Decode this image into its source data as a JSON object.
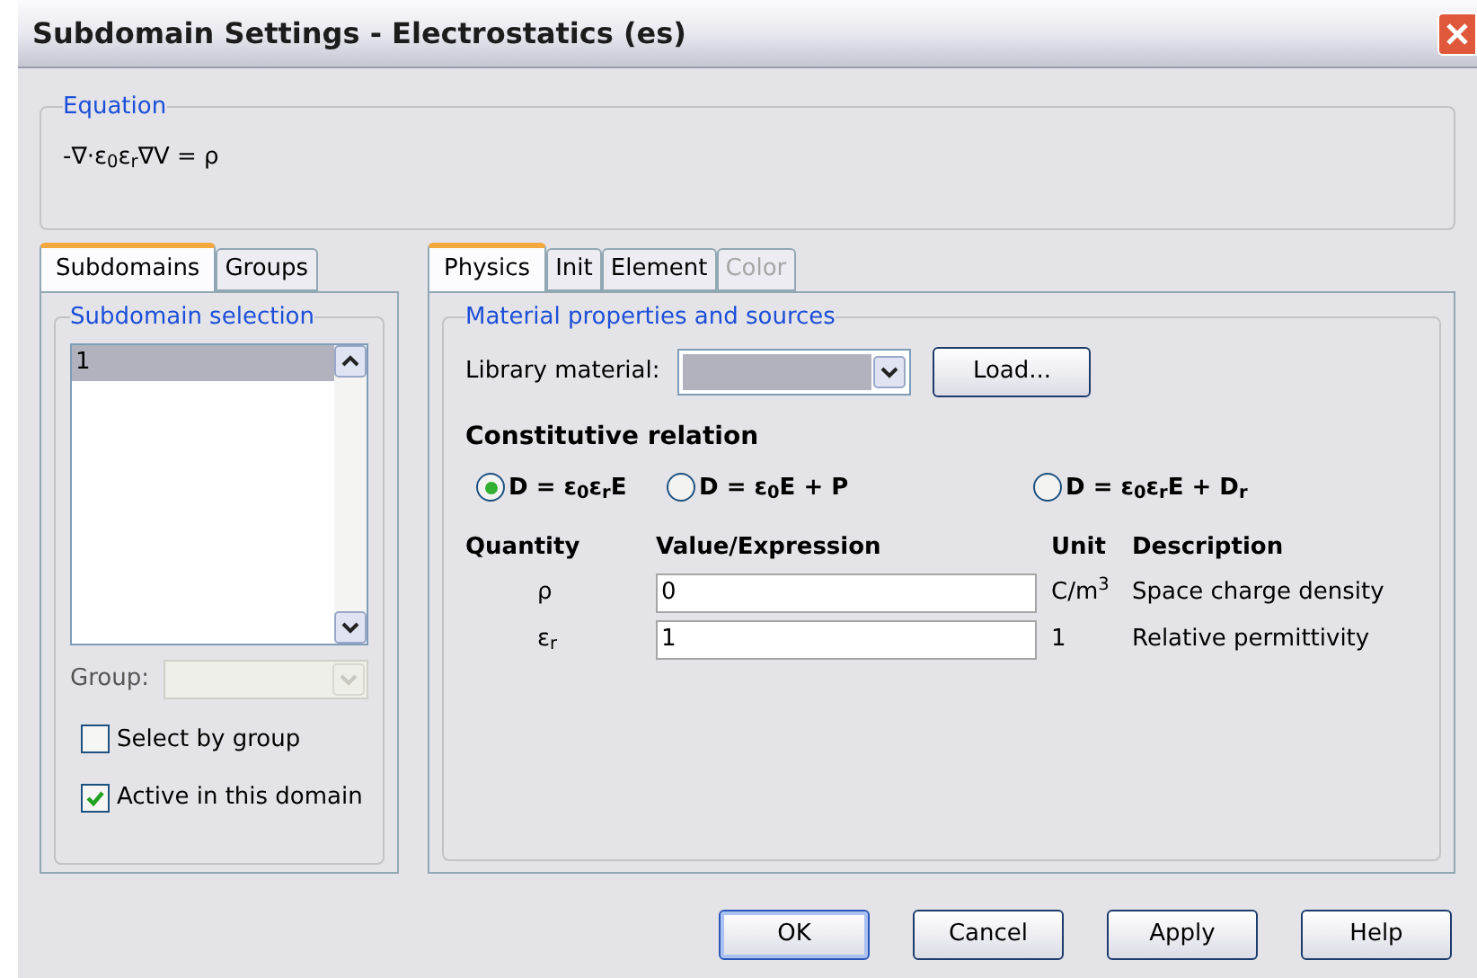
{
  "window": {
    "title": "Subdomain Settings - Electrostatics (es)"
  },
  "equation": {
    "title": "Equation",
    "formula": "-∇·ε$_{0}$ε$_{r}$∇V = ρ"
  },
  "left_tabs": [
    {
      "label": "Subdomains",
      "selected": true
    },
    {
      "label": "Groups",
      "selected": false
    }
  ],
  "subdomain_selection": {
    "title": "Subdomain selection",
    "items": [
      {
        "label": "1",
        "selected": true
      }
    ],
    "group_label": "Group:",
    "checkboxes": [
      {
        "label": "Select by group",
        "checked": false
      },
      {
        "label": "Active in this domain",
        "checked": true
      }
    ]
  },
  "right_tabs": [
    {
      "label": "Physics",
      "selected": true,
      "disabled": false
    },
    {
      "label": "Init",
      "selected": false,
      "disabled": false
    },
    {
      "label": "Element",
      "selected": false,
      "disabled": false
    },
    {
      "label": "Color",
      "selected": false,
      "disabled": true
    }
  ],
  "material": {
    "title": "Material properties and sources",
    "library_label": "Library material:",
    "load_button": "Load..."
  },
  "constitutive": {
    "title": "Constitutive relation",
    "options": [
      {
        "label": "D = ε$_{0}$ε$_{r}$E",
        "selected": true
      },
      {
        "label": "D = ε$_{0}$E + P",
        "selected": false
      },
      {
        "label": "D = ε$_{0}$ε$_{r}$E + D$_{r}$",
        "selected": false
      }
    ]
  },
  "table": {
    "columns": [
      "Quantity",
      "Value/Expression",
      "Unit",
      "Description"
    ],
    "rows": [
      {
        "quantity": "ρ",
        "value": "0",
        "unit": "C/m$^{3}$",
        "description": "Space charge density"
      },
      {
        "quantity": "ε$_{r}$",
        "value": "1",
        "unit": "1",
        "description": "Relative permittivity"
      }
    ]
  },
  "buttons": [
    {
      "label": "OK",
      "default": true
    },
    {
      "label": "Cancel",
      "default": false
    },
    {
      "label": "Apply",
      "default": false
    },
    {
      "label": "Help",
      "default": false
    }
  ]
}
